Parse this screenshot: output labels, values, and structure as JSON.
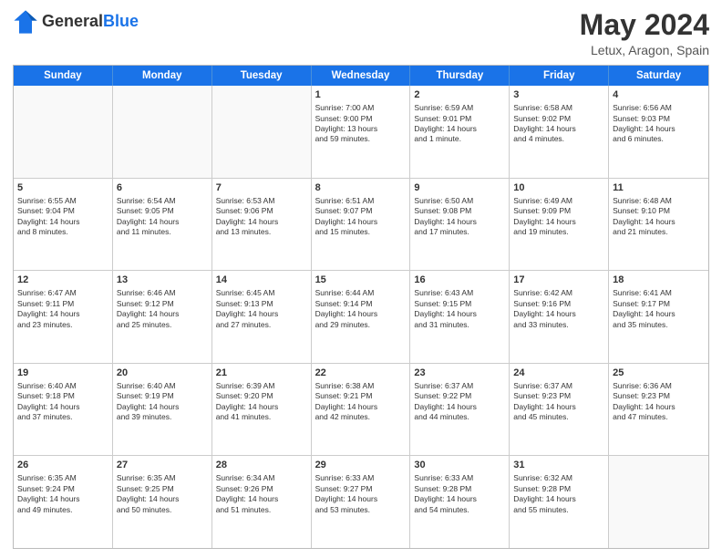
{
  "header": {
    "logo_general": "General",
    "logo_blue": "Blue",
    "title": "May 2024",
    "subtitle": "Letux, Aragon, Spain"
  },
  "weekdays": [
    "Sunday",
    "Monday",
    "Tuesday",
    "Wednesday",
    "Thursday",
    "Friday",
    "Saturday"
  ],
  "weeks": [
    [
      {
        "day": "",
        "lines": []
      },
      {
        "day": "",
        "lines": []
      },
      {
        "day": "",
        "lines": []
      },
      {
        "day": "1",
        "lines": [
          "Sunrise: 7:00 AM",
          "Sunset: 9:00 PM",
          "Daylight: 13 hours",
          "and 59 minutes."
        ]
      },
      {
        "day": "2",
        "lines": [
          "Sunrise: 6:59 AM",
          "Sunset: 9:01 PM",
          "Daylight: 14 hours",
          "and 1 minute."
        ]
      },
      {
        "day": "3",
        "lines": [
          "Sunrise: 6:58 AM",
          "Sunset: 9:02 PM",
          "Daylight: 14 hours",
          "and 4 minutes."
        ]
      },
      {
        "day": "4",
        "lines": [
          "Sunrise: 6:56 AM",
          "Sunset: 9:03 PM",
          "Daylight: 14 hours",
          "and 6 minutes."
        ]
      }
    ],
    [
      {
        "day": "5",
        "lines": [
          "Sunrise: 6:55 AM",
          "Sunset: 9:04 PM",
          "Daylight: 14 hours",
          "and 8 minutes."
        ]
      },
      {
        "day": "6",
        "lines": [
          "Sunrise: 6:54 AM",
          "Sunset: 9:05 PM",
          "Daylight: 14 hours",
          "and 11 minutes."
        ]
      },
      {
        "day": "7",
        "lines": [
          "Sunrise: 6:53 AM",
          "Sunset: 9:06 PM",
          "Daylight: 14 hours",
          "and 13 minutes."
        ]
      },
      {
        "day": "8",
        "lines": [
          "Sunrise: 6:51 AM",
          "Sunset: 9:07 PM",
          "Daylight: 14 hours",
          "and 15 minutes."
        ]
      },
      {
        "day": "9",
        "lines": [
          "Sunrise: 6:50 AM",
          "Sunset: 9:08 PM",
          "Daylight: 14 hours",
          "and 17 minutes."
        ]
      },
      {
        "day": "10",
        "lines": [
          "Sunrise: 6:49 AM",
          "Sunset: 9:09 PM",
          "Daylight: 14 hours",
          "and 19 minutes."
        ]
      },
      {
        "day": "11",
        "lines": [
          "Sunrise: 6:48 AM",
          "Sunset: 9:10 PM",
          "Daylight: 14 hours",
          "and 21 minutes."
        ]
      }
    ],
    [
      {
        "day": "12",
        "lines": [
          "Sunrise: 6:47 AM",
          "Sunset: 9:11 PM",
          "Daylight: 14 hours",
          "and 23 minutes."
        ]
      },
      {
        "day": "13",
        "lines": [
          "Sunrise: 6:46 AM",
          "Sunset: 9:12 PM",
          "Daylight: 14 hours",
          "and 25 minutes."
        ]
      },
      {
        "day": "14",
        "lines": [
          "Sunrise: 6:45 AM",
          "Sunset: 9:13 PM",
          "Daylight: 14 hours",
          "and 27 minutes."
        ]
      },
      {
        "day": "15",
        "lines": [
          "Sunrise: 6:44 AM",
          "Sunset: 9:14 PM",
          "Daylight: 14 hours",
          "and 29 minutes."
        ]
      },
      {
        "day": "16",
        "lines": [
          "Sunrise: 6:43 AM",
          "Sunset: 9:15 PM",
          "Daylight: 14 hours",
          "and 31 minutes."
        ]
      },
      {
        "day": "17",
        "lines": [
          "Sunrise: 6:42 AM",
          "Sunset: 9:16 PM",
          "Daylight: 14 hours",
          "and 33 minutes."
        ]
      },
      {
        "day": "18",
        "lines": [
          "Sunrise: 6:41 AM",
          "Sunset: 9:17 PM",
          "Daylight: 14 hours",
          "and 35 minutes."
        ]
      }
    ],
    [
      {
        "day": "19",
        "lines": [
          "Sunrise: 6:40 AM",
          "Sunset: 9:18 PM",
          "Daylight: 14 hours",
          "and 37 minutes."
        ]
      },
      {
        "day": "20",
        "lines": [
          "Sunrise: 6:40 AM",
          "Sunset: 9:19 PM",
          "Daylight: 14 hours",
          "and 39 minutes."
        ]
      },
      {
        "day": "21",
        "lines": [
          "Sunrise: 6:39 AM",
          "Sunset: 9:20 PM",
          "Daylight: 14 hours",
          "and 41 minutes."
        ]
      },
      {
        "day": "22",
        "lines": [
          "Sunrise: 6:38 AM",
          "Sunset: 9:21 PM",
          "Daylight: 14 hours",
          "and 42 minutes."
        ]
      },
      {
        "day": "23",
        "lines": [
          "Sunrise: 6:37 AM",
          "Sunset: 9:22 PM",
          "Daylight: 14 hours",
          "and 44 minutes."
        ]
      },
      {
        "day": "24",
        "lines": [
          "Sunrise: 6:37 AM",
          "Sunset: 9:23 PM",
          "Daylight: 14 hours",
          "and 45 minutes."
        ]
      },
      {
        "day": "25",
        "lines": [
          "Sunrise: 6:36 AM",
          "Sunset: 9:23 PM",
          "Daylight: 14 hours",
          "and 47 minutes."
        ]
      }
    ],
    [
      {
        "day": "26",
        "lines": [
          "Sunrise: 6:35 AM",
          "Sunset: 9:24 PM",
          "Daylight: 14 hours",
          "and 49 minutes."
        ]
      },
      {
        "day": "27",
        "lines": [
          "Sunrise: 6:35 AM",
          "Sunset: 9:25 PM",
          "Daylight: 14 hours",
          "and 50 minutes."
        ]
      },
      {
        "day": "28",
        "lines": [
          "Sunrise: 6:34 AM",
          "Sunset: 9:26 PM",
          "Daylight: 14 hours",
          "and 51 minutes."
        ]
      },
      {
        "day": "29",
        "lines": [
          "Sunrise: 6:33 AM",
          "Sunset: 9:27 PM",
          "Daylight: 14 hours",
          "and 53 minutes."
        ]
      },
      {
        "day": "30",
        "lines": [
          "Sunrise: 6:33 AM",
          "Sunset: 9:28 PM",
          "Daylight: 14 hours",
          "and 54 minutes."
        ]
      },
      {
        "day": "31",
        "lines": [
          "Sunrise: 6:32 AM",
          "Sunset: 9:28 PM",
          "Daylight: 14 hours",
          "and 55 minutes."
        ]
      },
      {
        "day": "",
        "lines": []
      }
    ]
  ]
}
